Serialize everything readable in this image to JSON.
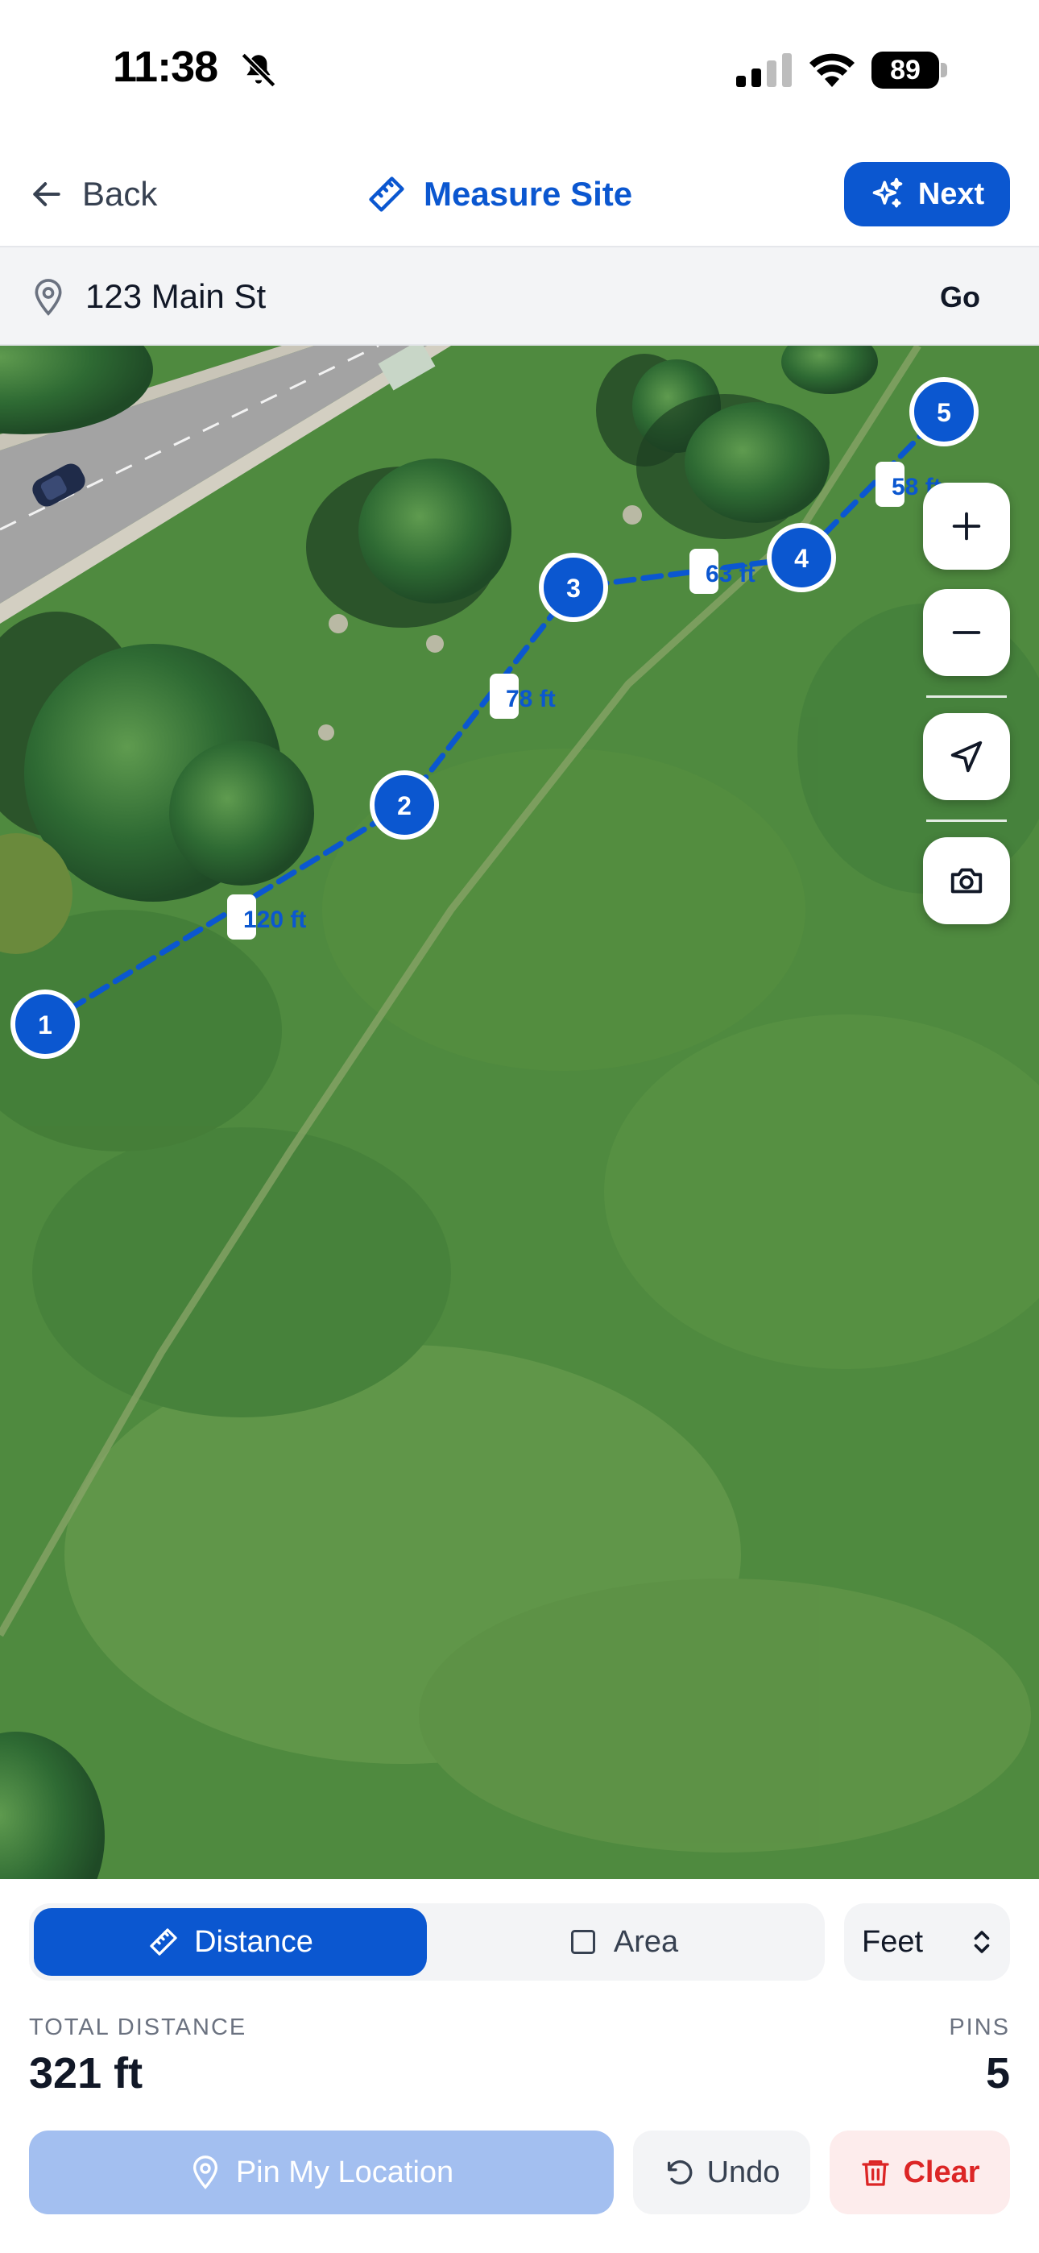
{
  "status_bar": {
    "time": "11:38",
    "battery": "89"
  },
  "header": {
    "back_label": "Back",
    "title": "Measure Site",
    "next_label": "Next"
  },
  "search": {
    "value": "123 Main St",
    "go_label": "Go"
  },
  "map": {
    "pins": [
      "1",
      "2",
      "3",
      "4",
      "5"
    ],
    "segments": [
      "120 ft",
      "78 ft",
      "63 ft",
      "58 ft"
    ]
  },
  "panel": {
    "mode_distance": "Distance",
    "mode_area": "Area",
    "unit": "Feet",
    "total_label": "TOTAL DISTANCE",
    "total_value": "321 ft",
    "pins_label": "PINS",
    "pins_value": "5",
    "pin_button": "Pin My Location",
    "undo_button": "Undo",
    "clear_button": "Clear"
  },
  "colors": {
    "accent": "#0b57d0",
    "danger": "#dc2626",
    "grass": "#4f8a3f"
  }
}
